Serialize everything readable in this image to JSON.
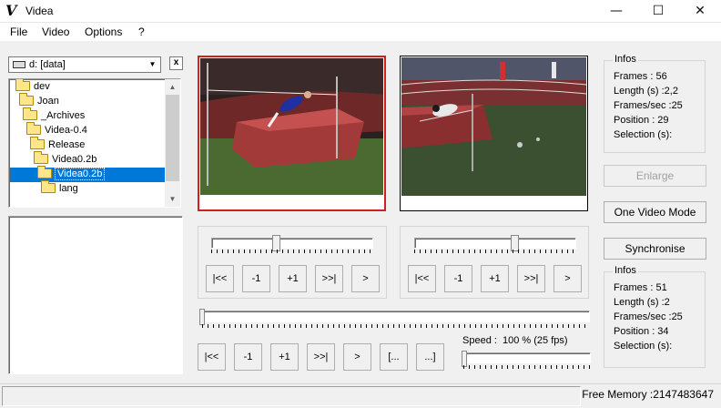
{
  "window": {
    "title": "Videa",
    "icon_letter": "V"
  },
  "winbuttons": {
    "minimize": "—",
    "maximize": "☐",
    "close": "✕"
  },
  "menu": [
    "File",
    "Video",
    "Options",
    "?"
  ],
  "drive": {
    "value": "d: [data]",
    "clear_label": "x"
  },
  "tree": [
    {
      "label": "dev",
      "indent": 0
    },
    {
      "label": "Joan",
      "indent": 1
    },
    {
      "label": "_Archives",
      "indent": 2
    },
    {
      "label": "Videa-0.4",
      "indent": 2
    },
    {
      "label": "Release",
      "indent": 3
    },
    {
      "label": "Videa0.2b",
      "indent": 4
    },
    {
      "label": "Videa0.2b",
      "indent": 5,
      "selected": true
    },
    {
      "label": "lang",
      "indent": 6
    }
  ],
  "left_controls": {
    "b1": "|<<",
    "b2": "-1",
    "b3": "+1",
    "b4": ">>|",
    "b5": ">",
    "slider_fraction": 0.4
  },
  "right_controls": {
    "b1": "|<<",
    "b2": "-1",
    "b3": "+1",
    "b4": ">>|",
    "b5": ">",
    "slider_fraction": 0.62
  },
  "bottom_controls": {
    "b1": "|<<",
    "b2": "-1",
    "b3": "+1",
    "b4": ">>|",
    "b5": ">",
    "b6": "[...",
    "b7": "...]"
  },
  "speed": {
    "label": "Speed :",
    "value": "100 % (25 fps)"
  },
  "infos1": {
    "title": "Infos",
    "frames": "Frames :  56",
    "length": "Length (s) :2,2",
    "fps": "Frames/sec :25",
    "position": "Position : 29",
    "selection": "Selection (s):"
  },
  "infos2": {
    "title": "Infos",
    "frames": "Frames :  51",
    "length": "Length (s) :2",
    "fps": "Frames/sec :25",
    "position": "Position : 34",
    "selection": "Selection (s):"
  },
  "side_buttons": {
    "enlarge": "Enlarge",
    "one_video": "One Video Mode",
    "synchronise": "Synchronise"
  },
  "status": {
    "free_memory": "Free Memory :2147483647"
  },
  "colors": {
    "selected_frame_border": "#d02020",
    "selection": "#0078d7",
    "track_red": "#8a2f2f",
    "mat": "#a33a3a",
    "floor": "#4a6a32"
  }
}
